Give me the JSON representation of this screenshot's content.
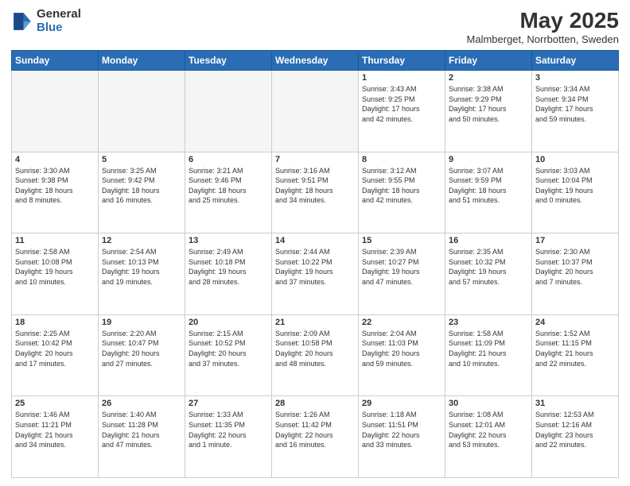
{
  "logo": {
    "general": "General",
    "blue": "Blue"
  },
  "title": "May 2025",
  "subtitle": "Malmberget, Norrbotten, Sweden",
  "days_header": [
    "Sunday",
    "Monday",
    "Tuesday",
    "Wednesday",
    "Thursday",
    "Friday",
    "Saturday"
  ],
  "weeks": [
    [
      {
        "day": "",
        "info": ""
      },
      {
        "day": "",
        "info": ""
      },
      {
        "day": "",
        "info": ""
      },
      {
        "day": "",
        "info": ""
      },
      {
        "day": "1",
        "info": "Sunrise: 3:43 AM\nSunset: 9:25 PM\nDaylight: 17 hours\nand 42 minutes."
      },
      {
        "day": "2",
        "info": "Sunrise: 3:38 AM\nSunset: 9:29 PM\nDaylight: 17 hours\nand 50 minutes."
      },
      {
        "day": "3",
        "info": "Sunrise: 3:34 AM\nSunset: 9:34 PM\nDaylight: 17 hours\nand 59 minutes."
      }
    ],
    [
      {
        "day": "4",
        "info": "Sunrise: 3:30 AM\nSunset: 9:38 PM\nDaylight: 18 hours\nand 8 minutes."
      },
      {
        "day": "5",
        "info": "Sunrise: 3:25 AM\nSunset: 9:42 PM\nDaylight: 18 hours\nand 16 minutes."
      },
      {
        "day": "6",
        "info": "Sunrise: 3:21 AM\nSunset: 9:46 PM\nDaylight: 18 hours\nand 25 minutes."
      },
      {
        "day": "7",
        "info": "Sunrise: 3:16 AM\nSunset: 9:51 PM\nDaylight: 18 hours\nand 34 minutes."
      },
      {
        "day": "8",
        "info": "Sunrise: 3:12 AM\nSunset: 9:55 PM\nDaylight: 18 hours\nand 42 minutes."
      },
      {
        "day": "9",
        "info": "Sunrise: 3:07 AM\nSunset: 9:59 PM\nDaylight: 18 hours\nand 51 minutes."
      },
      {
        "day": "10",
        "info": "Sunrise: 3:03 AM\nSunset: 10:04 PM\nDaylight: 19 hours\nand 0 minutes."
      }
    ],
    [
      {
        "day": "11",
        "info": "Sunrise: 2:58 AM\nSunset: 10:08 PM\nDaylight: 19 hours\nand 10 minutes."
      },
      {
        "day": "12",
        "info": "Sunrise: 2:54 AM\nSunset: 10:13 PM\nDaylight: 19 hours\nand 19 minutes."
      },
      {
        "day": "13",
        "info": "Sunrise: 2:49 AM\nSunset: 10:18 PM\nDaylight: 19 hours\nand 28 minutes."
      },
      {
        "day": "14",
        "info": "Sunrise: 2:44 AM\nSunset: 10:22 PM\nDaylight: 19 hours\nand 37 minutes."
      },
      {
        "day": "15",
        "info": "Sunrise: 2:39 AM\nSunset: 10:27 PM\nDaylight: 19 hours\nand 47 minutes."
      },
      {
        "day": "16",
        "info": "Sunrise: 2:35 AM\nSunset: 10:32 PM\nDaylight: 19 hours\nand 57 minutes."
      },
      {
        "day": "17",
        "info": "Sunrise: 2:30 AM\nSunset: 10:37 PM\nDaylight: 20 hours\nand 7 minutes."
      }
    ],
    [
      {
        "day": "18",
        "info": "Sunrise: 2:25 AM\nSunset: 10:42 PM\nDaylight: 20 hours\nand 17 minutes."
      },
      {
        "day": "19",
        "info": "Sunrise: 2:20 AM\nSunset: 10:47 PM\nDaylight: 20 hours\nand 27 minutes."
      },
      {
        "day": "20",
        "info": "Sunrise: 2:15 AM\nSunset: 10:52 PM\nDaylight: 20 hours\nand 37 minutes."
      },
      {
        "day": "21",
        "info": "Sunrise: 2:09 AM\nSunset: 10:58 PM\nDaylight: 20 hours\nand 48 minutes."
      },
      {
        "day": "22",
        "info": "Sunrise: 2:04 AM\nSunset: 11:03 PM\nDaylight: 20 hours\nand 59 minutes."
      },
      {
        "day": "23",
        "info": "Sunrise: 1:58 AM\nSunset: 11:09 PM\nDaylight: 21 hours\nand 10 minutes."
      },
      {
        "day": "24",
        "info": "Sunrise: 1:52 AM\nSunset: 11:15 PM\nDaylight: 21 hours\nand 22 minutes."
      }
    ],
    [
      {
        "day": "25",
        "info": "Sunrise: 1:46 AM\nSunset: 11:21 PM\nDaylight: 21 hours\nand 34 minutes."
      },
      {
        "day": "26",
        "info": "Sunrise: 1:40 AM\nSunset: 11:28 PM\nDaylight: 21 hours\nand 47 minutes."
      },
      {
        "day": "27",
        "info": "Sunrise: 1:33 AM\nSunset: 11:35 PM\nDaylight: 22 hours\nand 1 minute."
      },
      {
        "day": "28",
        "info": "Sunrise: 1:26 AM\nSunset: 11:42 PM\nDaylight: 22 hours\nand 16 minutes."
      },
      {
        "day": "29",
        "info": "Sunrise: 1:18 AM\nSunset: 11:51 PM\nDaylight: 22 hours\nand 33 minutes."
      },
      {
        "day": "30",
        "info": "Sunrise: 1:08 AM\nSunset: 12:01 AM\nDaylight: 22 hours\nand 53 minutes."
      },
      {
        "day": "31",
        "info": "Sunrise: 12:53 AM\nSunset: 12:16 AM\nDaylight: 23 hours\nand 22 minutes."
      }
    ]
  ]
}
